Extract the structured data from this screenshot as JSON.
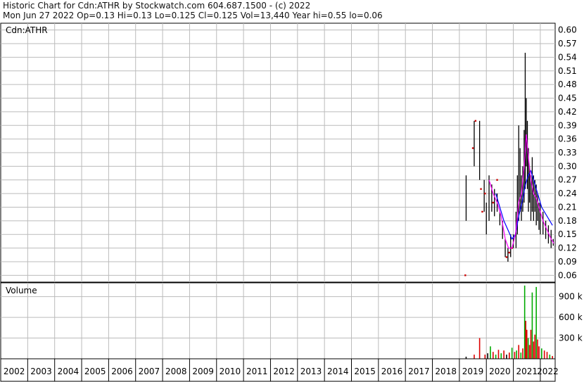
{
  "header": {
    "line1": "Historic Chart for Cdn:ATHR by Stockwatch.com 604.687.1500 - (c) 2022",
    "line2": "Mon Jun 27 2022  Op=0.13  Hi=0.13  Lo=0.125  Cl=0.125  Vol=13,440  Year hi=0.55  lo=0.06"
  },
  "chart_data": [
    {
      "type": "line",
      "title": "Cdn:ATHR",
      "y_ticks": [
        "0.60",
        "0.57",
        "0.54",
        "0.51",
        "0.48",
        "0.45",
        "0.42",
        "0.39",
        "0.36",
        "0.33",
        "0.30",
        "0.27",
        "0.24",
        "0.21",
        "0.18",
        "0.15",
        "0.12",
        "0.09",
        "0.06"
      ],
      "ylim": [
        0.045,
        0.615
      ],
      "xlim": [
        2002.0,
        2022.55
      ],
      "x_labels": [
        "2002",
        "2003",
        "2004",
        "2005",
        "2006",
        "2007",
        "2008",
        "2009",
        "2010",
        "2011",
        "2012",
        "2013",
        "2014",
        "2015",
        "2016",
        "2017",
        "2018",
        "2019",
        "2020",
        "2021",
        "2022"
      ],
      "grid": true,
      "colors": {
        "price": "#000000",
        "ma_short": "#ff00ff",
        "ma_long": "#0000ff",
        "marker": "#cc0000"
      },
      "price_ranges": [
        {
          "x": 2019.25,
          "lo": 0.18,
          "hi": 0.28
        },
        {
          "x": 2019.55,
          "lo": 0.3,
          "hi": 0.4
        },
        {
          "x": 2019.75,
          "lo": 0.27,
          "hi": 0.4
        },
        {
          "x": 2019.92,
          "lo": 0.2,
          "hi": 0.27
        },
        {
          "x": 2020.0,
          "lo": 0.15,
          "hi": 0.22
        },
        {
          "x": 2020.1,
          "lo": 0.18,
          "hi": 0.28
        },
        {
          "x": 2020.2,
          "lo": 0.2,
          "hi": 0.26
        },
        {
          "x": 2020.3,
          "lo": 0.19,
          "hi": 0.25
        },
        {
          "x": 2020.4,
          "lo": 0.2,
          "hi": 0.24
        },
        {
          "x": 2020.5,
          "lo": 0.17,
          "hi": 0.2
        },
        {
          "x": 2020.6,
          "lo": 0.14,
          "hi": 0.18
        },
        {
          "x": 2020.7,
          "lo": 0.1,
          "hi": 0.14
        },
        {
          "x": 2020.8,
          "lo": 0.09,
          "hi": 0.12
        },
        {
          "x": 2020.9,
          "lo": 0.1,
          "hi": 0.15
        },
        {
          "x": 2021.0,
          "lo": 0.12,
          "hi": 0.15
        },
        {
          "x": 2021.1,
          "lo": 0.12,
          "hi": 0.2
        },
        {
          "x": 2021.15,
          "lo": 0.15,
          "hi": 0.28
        },
        {
          "x": 2021.2,
          "lo": 0.18,
          "hi": 0.39
        },
        {
          "x": 2021.25,
          "lo": 0.2,
          "hi": 0.34
        },
        {
          "x": 2021.3,
          "lo": 0.18,
          "hi": 0.28
        },
        {
          "x": 2021.35,
          "lo": 0.2,
          "hi": 0.3
        },
        {
          "x": 2021.4,
          "lo": 0.22,
          "hi": 0.38
        },
        {
          "x": 2021.44,
          "lo": 0.25,
          "hi": 0.55
        },
        {
          "x": 2021.48,
          "lo": 0.3,
          "hi": 0.45
        },
        {
          "x": 2021.52,
          "lo": 0.25,
          "hi": 0.4
        },
        {
          "x": 2021.56,
          "lo": 0.2,
          "hi": 0.34
        },
        {
          "x": 2021.6,
          "lo": 0.22,
          "hi": 0.3
        },
        {
          "x": 2021.65,
          "lo": 0.18,
          "hi": 0.28
        },
        {
          "x": 2021.7,
          "lo": 0.2,
          "hi": 0.32
        },
        {
          "x": 2021.75,
          "lo": 0.18,
          "hi": 0.28
        },
        {
          "x": 2021.8,
          "lo": 0.2,
          "hi": 0.27
        },
        {
          "x": 2021.85,
          "lo": 0.17,
          "hi": 0.26
        },
        {
          "x": 2021.9,
          "lo": 0.18,
          "hi": 0.24
        },
        {
          "x": 2021.95,
          "lo": 0.16,
          "hi": 0.22
        },
        {
          "x": 2022.0,
          "lo": 0.15,
          "hi": 0.22
        },
        {
          "x": 2022.1,
          "lo": 0.15,
          "hi": 0.2
        },
        {
          "x": 2022.2,
          "lo": 0.14,
          "hi": 0.18
        },
        {
          "x": 2022.3,
          "lo": 0.13,
          "hi": 0.17
        },
        {
          "x": 2022.4,
          "lo": 0.12,
          "hi": 0.16
        },
        {
          "x": 2022.48,
          "lo": 0.125,
          "hi": 0.14
        }
      ],
      "red_markers": [
        {
          "x": 2019.22,
          "y": 0.06
        },
        {
          "x": 2019.5,
          "y": 0.34
        },
        {
          "x": 2019.6,
          "y": 0.4
        },
        {
          "x": 2019.8,
          "y": 0.25
        },
        {
          "x": 2019.85,
          "y": 0.2
        },
        {
          "x": 2019.95,
          "y": 0.24
        },
        {
          "x": 2020.25,
          "y": 0.22
        },
        {
          "x": 2020.4,
          "y": 0.27
        },
        {
          "x": 2020.75,
          "y": 0.1
        },
        {
          "x": 2020.85,
          "y": 0.11
        },
        {
          "x": 2020.95,
          "y": 0.12
        }
      ],
      "ma_short": [
        {
          "x": 2020.1,
          "y": 0.27
        },
        {
          "x": 2020.25,
          "y": 0.24
        },
        {
          "x": 2020.4,
          "y": 0.22
        },
        {
          "x": 2020.55,
          "y": 0.19
        },
        {
          "x": 2020.7,
          "y": 0.14
        },
        {
          "x": 2020.82,
          "y": 0.12
        },
        {
          "x": 2020.95,
          "y": 0.12
        },
        {
          "x": 2021.08,
          "y": 0.15
        },
        {
          "x": 2021.2,
          "y": 0.22
        },
        {
          "x": 2021.3,
          "y": 0.24
        },
        {
          "x": 2021.4,
          "y": 0.3
        },
        {
          "x": 2021.48,
          "y": 0.37
        },
        {
          "x": 2021.56,
          "y": 0.32
        },
        {
          "x": 2021.65,
          "y": 0.27
        },
        {
          "x": 2021.75,
          "y": 0.24
        },
        {
          "x": 2021.85,
          "y": 0.23
        },
        {
          "x": 2021.95,
          "y": 0.21
        },
        {
          "x": 2022.1,
          "y": 0.18
        },
        {
          "x": 2022.25,
          "y": 0.16
        },
        {
          "x": 2022.4,
          "y": 0.14
        },
        {
          "x": 2022.5,
          "y": 0.13
        }
      ],
      "ma_long": [
        {
          "x": 2020.35,
          "y": 0.24
        },
        {
          "x": 2020.5,
          "y": 0.21
        },
        {
          "x": 2020.65,
          "y": 0.18
        },
        {
          "x": 2020.8,
          "y": 0.16
        },
        {
          "x": 2020.95,
          "y": 0.14
        },
        {
          "x": 2021.08,
          "y": 0.15
        },
        {
          "x": 2021.2,
          "y": 0.19
        },
        {
          "x": 2021.32,
          "y": 0.22
        },
        {
          "x": 2021.45,
          "y": 0.26
        },
        {
          "x": 2021.55,
          "y": 0.28
        },
        {
          "x": 2021.65,
          "y": 0.29
        },
        {
          "x": 2021.75,
          "y": 0.27
        },
        {
          "x": 2021.9,
          "y": 0.24
        },
        {
          "x": 2022.05,
          "y": 0.21
        },
        {
          "x": 2022.25,
          "y": 0.19
        },
        {
          "x": 2022.45,
          "y": 0.17
        }
      ]
    },
    {
      "type": "bar",
      "title": "Volume",
      "y_ticks": [
        "900 k",
        "600 k",
        "300 k"
      ],
      "ylim": [
        0,
        1100
      ],
      "ylabel_unit": "k",
      "colors": {
        "up": "#00aa00",
        "down": "#dd0000",
        "flat": "#000000"
      },
      "bars": [
        {
          "x": 2019.25,
          "v": 30,
          "c": "flat"
        },
        {
          "x": 2019.55,
          "v": 60,
          "c": "down"
        },
        {
          "x": 2019.75,
          "v": 300,
          "c": "down"
        },
        {
          "x": 2019.95,
          "v": 60,
          "c": "down"
        },
        {
          "x": 2020.05,
          "v": 80,
          "c": "flat"
        },
        {
          "x": 2020.15,
          "v": 180,
          "c": "up"
        },
        {
          "x": 2020.25,
          "v": 100,
          "c": "down"
        },
        {
          "x": 2020.35,
          "v": 60,
          "c": "up"
        },
        {
          "x": 2020.45,
          "v": 130,
          "c": "down"
        },
        {
          "x": 2020.55,
          "v": 80,
          "c": "up"
        },
        {
          "x": 2020.65,
          "v": 120,
          "c": "down"
        },
        {
          "x": 2020.75,
          "v": 60,
          "c": "flat"
        },
        {
          "x": 2020.85,
          "v": 90,
          "c": "down"
        },
        {
          "x": 2020.95,
          "v": 160,
          "c": "up"
        },
        {
          "x": 2021.05,
          "v": 100,
          "c": "down"
        },
        {
          "x": 2021.12,
          "v": 120,
          "c": "up"
        },
        {
          "x": 2021.2,
          "v": 200,
          "c": "down"
        },
        {
          "x": 2021.28,
          "v": 90,
          "c": "up"
        },
        {
          "x": 2021.35,
          "v": 150,
          "c": "down"
        },
        {
          "x": 2021.42,
          "v": 1060,
          "c": "up"
        },
        {
          "x": 2021.46,
          "v": 550,
          "c": "down"
        },
        {
          "x": 2021.5,
          "v": 420,
          "c": "down"
        },
        {
          "x": 2021.55,
          "v": 300,
          "c": "up"
        },
        {
          "x": 2021.6,
          "v": 200,
          "c": "down"
        },
        {
          "x": 2021.65,
          "v": 420,
          "c": "down"
        },
        {
          "x": 2021.7,
          "v": 960,
          "c": "up"
        },
        {
          "x": 2021.75,
          "v": 250,
          "c": "down"
        },
        {
          "x": 2021.8,
          "v": 350,
          "c": "down"
        },
        {
          "x": 2021.85,
          "v": 1040,
          "c": "up"
        },
        {
          "x": 2021.9,
          "v": 280,
          "c": "down"
        },
        {
          "x": 2021.95,
          "v": 180,
          "c": "down"
        },
        {
          "x": 2022.05,
          "v": 150,
          "c": "up"
        },
        {
          "x": 2022.15,
          "v": 120,
          "c": "down"
        },
        {
          "x": 2022.25,
          "v": 100,
          "c": "down"
        },
        {
          "x": 2022.35,
          "v": 60,
          "c": "up"
        },
        {
          "x": 2022.45,
          "v": 40,
          "c": "down"
        }
      ]
    }
  ]
}
